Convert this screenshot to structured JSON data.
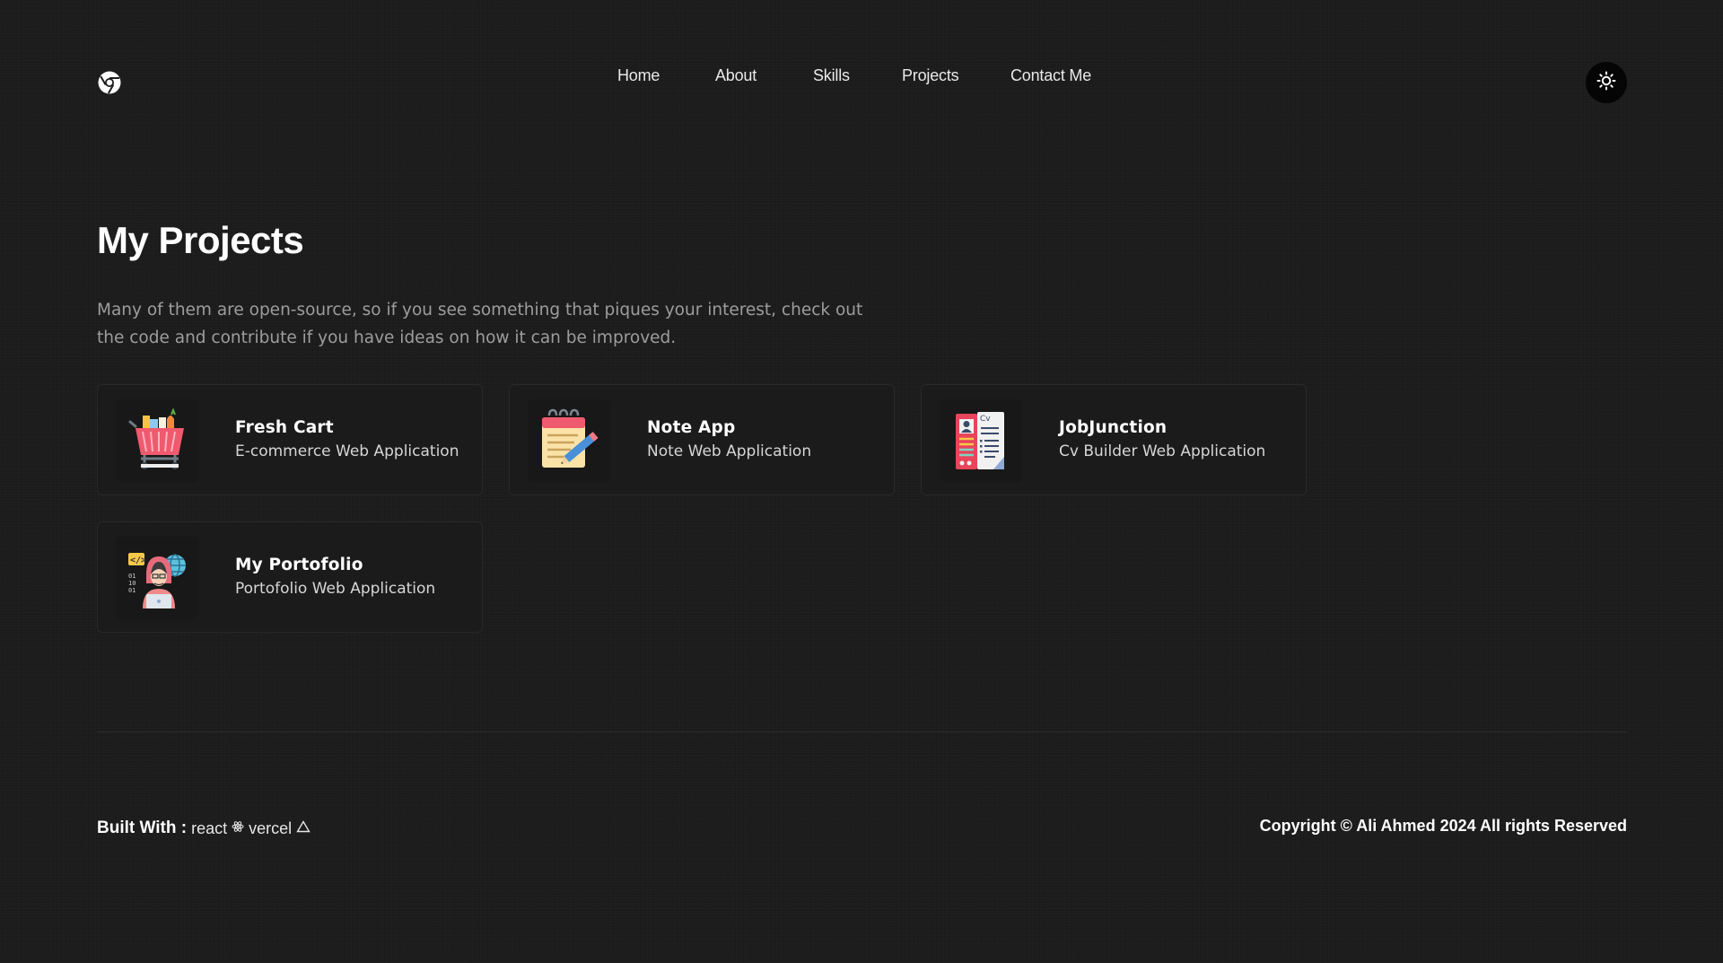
{
  "header": {
    "logo_icon": "chrome-style-logo-icon",
    "nav": [
      {
        "label": "Home"
      },
      {
        "label": "About"
      },
      {
        "label": "Skills"
      },
      {
        "label": "Projects"
      },
      {
        "label": "Contact Me"
      }
    ],
    "theme_toggle_icon": "sun-icon"
  },
  "main": {
    "title": "My Projects",
    "intro": "Many of them are open-source, so if you see something that piques your interest, check out the code and contribute if you have ideas on how it can be improved.",
    "projects": [
      {
        "name": "Fresh Cart",
        "description": "E-commerce Web Application",
        "icon": "shopping-cart-icon"
      },
      {
        "name": "Note App",
        "description": "Note Web Application",
        "icon": "notepad-icon"
      },
      {
        "name": "JobJunction",
        "description": "Cv Builder Web Application",
        "icon": "cv-document-icon"
      },
      {
        "name": "My Portofolio",
        "description": "Portofolio Web Application",
        "icon": "developer-avatar-icon"
      }
    ]
  },
  "footer": {
    "built_label": "Built With :",
    "tech": [
      {
        "label": "react",
        "icon": "react-atom-icon"
      },
      {
        "label": "vercel",
        "icon": "vercel-triangle-icon"
      }
    ],
    "copyright": "Copyright © Ali Ahmed 2024 All rights Reserved"
  },
  "colors": {
    "background": "#1c1c1c",
    "card_border": "#292929",
    "muted_text": "#9d9d9d",
    "toggle_bg": "#050505"
  }
}
